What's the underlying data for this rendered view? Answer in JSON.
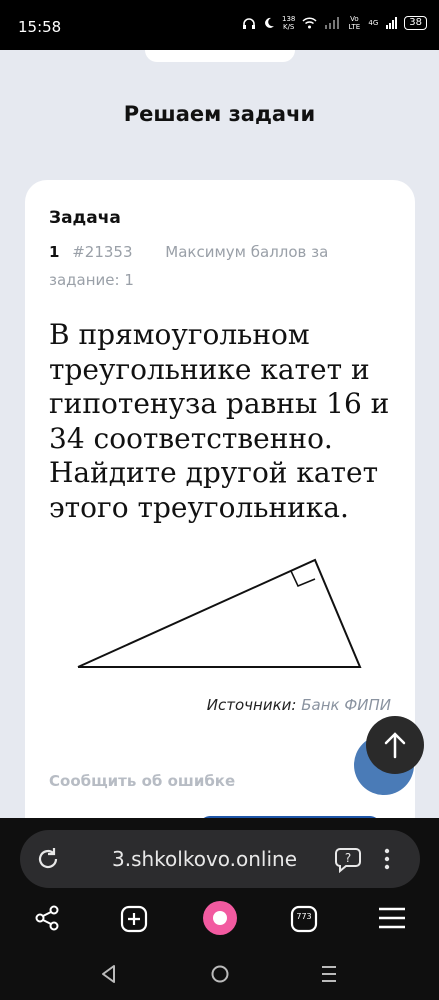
{
  "status": {
    "time": "15:58",
    "speed_value": "138",
    "speed_unit": "K/S",
    "net1": "Vo LTE",
    "net2": "4G",
    "battery": "38"
  },
  "page": {
    "section_title": "Решаем задачи"
  },
  "task": {
    "label": "Задача",
    "number": "1",
    "id": "#21353",
    "max_score": "Максимум баллов за задание: 1",
    "text": "В прямоугольном треугольнике катет и гипотенуза равны 16 и 34 соответственно. Найдите другой катет этого треугольника.",
    "source_label": "Источники:",
    "source_value": "Банк ФИПИ",
    "report": "Сообщить об ошибке"
  },
  "browser": {
    "url": "3.shkolkovo.online",
    "tabs_count": "773"
  },
  "colors": {
    "accent_blue": "#1e56a8",
    "chat_button": "#4a7bb7",
    "card": "#ffffff",
    "page_bg": "#e6e9f0"
  },
  "icons": [
    "wifi-icon",
    "signal-icon",
    "battery-icon",
    "reload-icon",
    "chat-help-icon",
    "more-vert-icon",
    "share-icon",
    "new-tab-icon",
    "alice-icon",
    "tabs-icon",
    "menu-icon",
    "back-icon",
    "home-icon",
    "recents-icon",
    "arrow-up-icon"
  ]
}
